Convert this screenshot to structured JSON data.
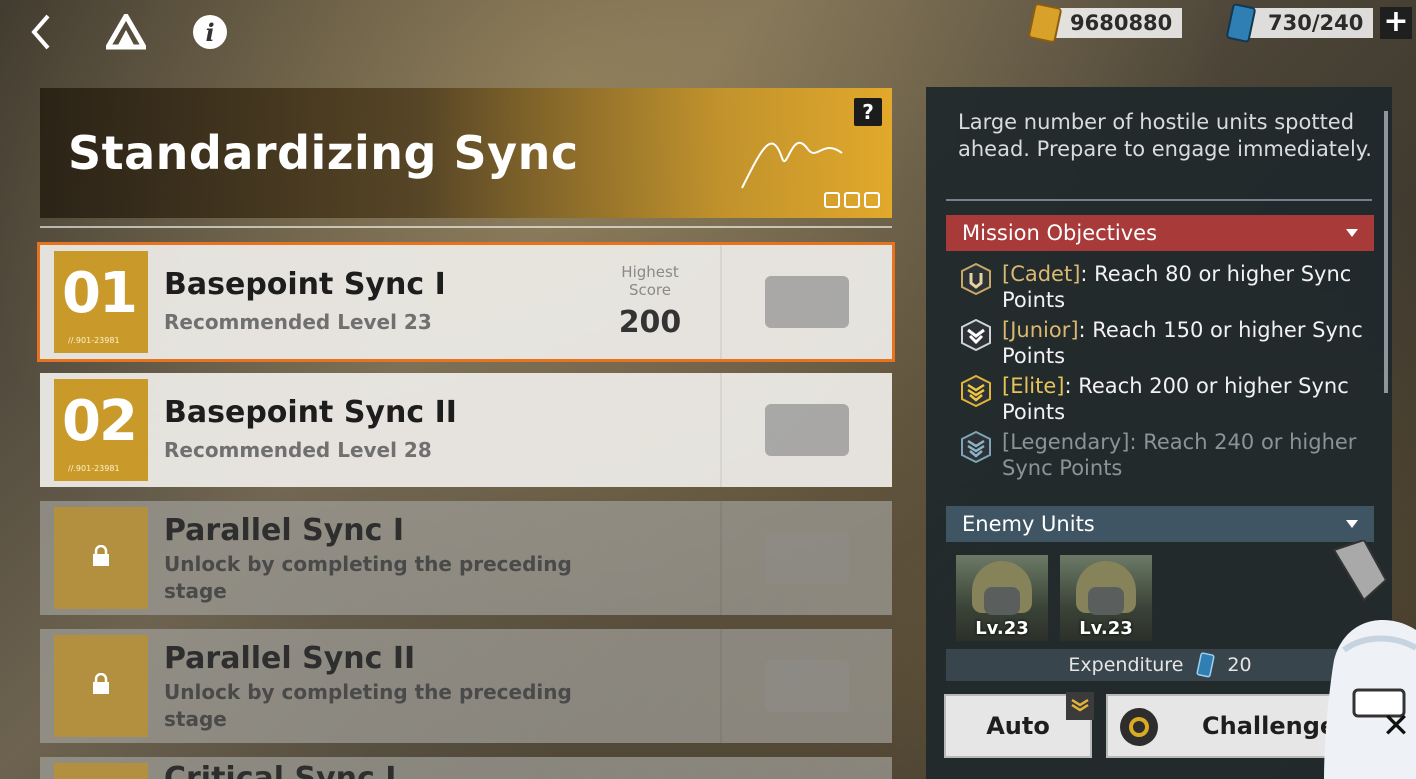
{
  "topnav": {
    "back_icon": "chevron-left-icon",
    "drive_icon": "triangle-logo-icon",
    "info_icon": "info-icon"
  },
  "resources": {
    "gold": "9680880",
    "stamina": "730/240",
    "add_label": "+"
  },
  "banner": {
    "title": "Standardizing Sync",
    "help_label": "?"
  },
  "stages": [
    {
      "num": "01",
      "code": "//.901-23981",
      "name": "Basepoint Sync I",
      "sub": "Recommended Level 23",
      "score_label": "Highest Score",
      "score": "200",
      "selected": true,
      "locked": false
    },
    {
      "num": "02",
      "code": "//.901-23981",
      "name": "Basepoint Sync II",
      "sub": "Recommended Level 28",
      "locked": false
    },
    {
      "name": "Parallel Sync I",
      "sub": "Unlock by completing the preceding stage",
      "locked": true
    },
    {
      "name": "Parallel Sync II",
      "sub": "Unlock by completing the preceding stage",
      "locked": true
    },
    {
      "name": "Critical Sync I",
      "locked": true
    }
  ],
  "panel": {
    "description": "Large number of hostile units spotted ahead. Prepare to engage immediately.",
    "objectives_header": "Mission Objectives",
    "objectives": [
      {
        "rank": "[Cadet]",
        "text": ": Reach 80 or higher Sync Points",
        "achieved": true
      },
      {
        "rank": "[Junior]",
        "text": ": Reach 150 or higher Sync Points",
        "achieved": true
      },
      {
        "rank": "[Elite]",
        "text": ": Reach 200 or higher Sync Points",
        "achieved": true
      },
      {
        "rank": "[Legendary]",
        "text": ": Reach 240 or higher Sync Points",
        "achieved": false
      }
    ],
    "enemies_header": "Enemy Units",
    "enemies": [
      {
        "level": "Lv.23"
      },
      {
        "level": "Lv.23"
      }
    ],
    "expenditure_label": "Expenditure",
    "expenditure_cost": "20"
  },
  "actions": {
    "auto_label": "Auto",
    "challenge_label": "Challenge",
    "close_label": "✕"
  },
  "colors": {
    "accent_orange": "#e8731e",
    "stage_gold": "#c99a2a",
    "objectives_header": "#a83a3a",
    "enemies_header": "#3f5563",
    "rank_gold": "#d9b870"
  }
}
